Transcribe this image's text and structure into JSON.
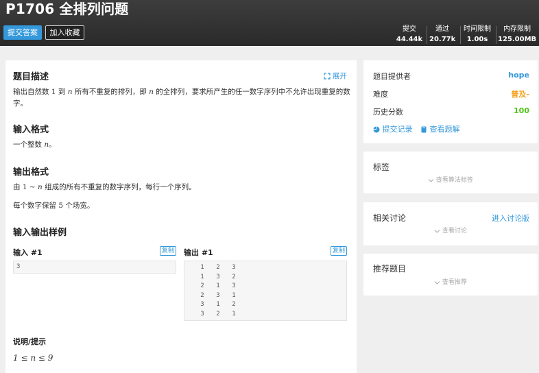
{
  "header": {
    "title": "P1706 全排列问题",
    "submit_label": "提交答案",
    "favorite_label": "加入收藏",
    "stats": [
      {
        "label": "提交",
        "value": "44.44k"
      },
      {
        "label": "通过",
        "value": "20.77k"
      },
      {
        "label": "时间限制",
        "value": "1.00s"
      },
      {
        "label": "内存限制",
        "value": "125.00MB"
      }
    ]
  },
  "problem": {
    "expand_label": "展开",
    "desc_title": "题目描述",
    "desc_line1_a": "输出自然数 ",
    "desc_line1_b": "1",
    "desc_line1_c": " 到 ",
    "desc_line1_d": "n",
    "desc_line1_e": " 所有不重复的排列，即 ",
    "desc_line1_f": "n",
    "desc_line1_g": " 的全排列，要求所产生的任一数字序列中不允许出现重复的数",
    "desc_line2": "字。",
    "input_title": "输入格式",
    "input_text_a": "一个整数 ",
    "input_text_b": "n",
    "input_text_c": "。",
    "output_title": "输出格式",
    "output_text_a": "由 ",
    "output_text_b": "1 ∼ ",
    "output_text_c": "n",
    "output_text_d": " 组成的所有不重复的数字序列，每行一个序列。",
    "output_text2_a": "每个数字保留 ",
    "output_text2_b": "5",
    "output_text2_c": " 个场宽。",
    "sample_title": "输入输出样例",
    "input_sample_label": "输入 #1",
    "output_sample_label": "输出 #1",
    "copy_label": "复制",
    "input_sample": "3",
    "output_sample": [
      [
        "1",
        "2",
        "3"
      ],
      [
        "1",
        "3",
        "2"
      ],
      [
        "2",
        "1",
        "3"
      ],
      [
        "2",
        "3",
        "1"
      ],
      [
        "3",
        "1",
        "2"
      ],
      [
        "3",
        "2",
        "1"
      ]
    ],
    "hint_title": "说明/提示",
    "hint_formula": "1 ≤ n ≤ 9"
  },
  "info": {
    "provider_label": "题目提供者",
    "provider_value": "hope",
    "difficulty_label": "难度",
    "difficulty_value": "普及-",
    "score_label": "历史分数",
    "score_value": "100",
    "records_link": "提交记录",
    "solutions_link": "查看题解"
  },
  "tags": {
    "title": "标签",
    "hint": "查看算法标签"
  },
  "discuss": {
    "title": "相关讨论",
    "link": "进入讨论版",
    "hint": "查看讨论"
  },
  "recommend": {
    "title": "推荐题目",
    "hint": "查看推荐"
  },
  "colors": {
    "accent": "#3498db",
    "difficulty": "#f39c11",
    "score": "#52c41a",
    "header_bg": "#2f2f2f"
  }
}
